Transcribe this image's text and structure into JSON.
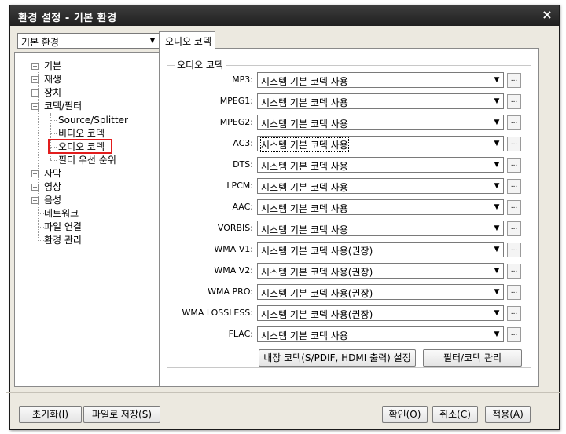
{
  "window": {
    "title": "환경 설정 - 기본 환경",
    "close_glyph": "×"
  },
  "profile_select": {
    "value": "기본 환경"
  },
  "tree": {
    "items": [
      {
        "label": "기본",
        "toggle": "+"
      },
      {
        "label": "재생",
        "toggle": "+"
      },
      {
        "label": "장치",
        "toggle": "+"
      },
      {
        "label": "코덱/필터",
        "toggle": "−"
      },
      {
        "label": "Source/Splitter"
      },
      {
        "label": "비디오 코덱"
      },
      {
        "label": "오디오 코덱"
      },
      {
        "label": "필터 우선 순위"
      },
      {
        "label": "자막",
        "toggle": "+"
      },
      {
        "label": "영상",
        "toggle": "+"
      },
      {
        "label": "음성",
        "toggle": "+"
      },
      {
        "label": "네트워크"
      },
      {
        "label": "파일 연결"
      },
      {
        "label": "환경 관리"
      }
    ]
  },
  "tab": {
    "label": "오디오 코덱"
  },
  "group": {
    "title": "오디오 코덱"
  },
  "codecs": [
    {
      "label": "MP3:",
      "value": "시스템 기본 코덱 사용"
    },
    {
      "label": "MPEG1:",
      "value": "시스템 기본 코덱 사용"
    },
    {
      "label": "MPEG2:",
      "value": "시스템 기본 코덱 사용"
    },
    {
      "label": "AC3:",
      "value": "시스템 기본 코덱 사용"
    },
    {
      "label": "DTS:",
      "value": "시스템 기본 코덱 사용"
    },
    {
      "label": "LPCM:",
      "value": "시스템 기본 코덱 사용"
    },
    {
      "label": "AAC:",
      "value": "시스템 기본 코덱 사용"
    },
    {
      "label": "VORBIS:",
      "value": "시스템 기본 코덱 사용"
    },
    {
      "label": "WMA V1:",
      "value": "시스템 기본 코덱 사용(권장)"
    },
    {
      "label": "WMA V2:",
      "value": "시스템 기본 코덱 사용(권장)"
    },
    {
      "label": "WMA PRO:",
      "value": "시스템 기본 코덱 사용(권장)"
    },
    {
      "label": "WMA LOSSLESS:",
      "value": "시스템 기본 코덱 사용(권장)"
    },
    {
      "label": "FLAC:",
      "value": "시스템 기본 코덱 사용"
    }
  ],
  "combo_arrow": "▼",
  "dots_label": "...",
  "actions": {
    "internal_codec": "내장 코덱(S/PDIF, HDMI 출력) 설정",
    "filter_codec_manage": "필터/코덱 관리"
  },
  "footer": {
    "reset": "초기화(I)",
    "save_file": "파일로 저장(S)",
    "ok": "확인(O)",
    "cancel": "취소(C)",
    "apply": "적용(A)"
  }
}
